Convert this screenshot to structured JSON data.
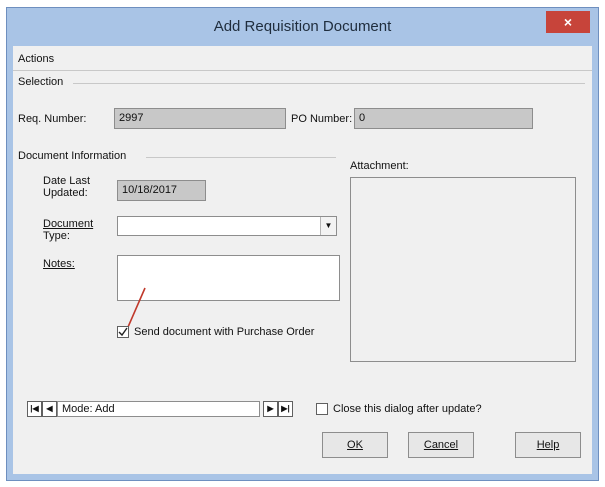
{
  "window": {
    "title": "Add Requisition Document",
    "close": "×"
  },
  "menu": {
    "actions": "Actions"
  },
  "selection": {
    "label": "Selection",
    "req_label": "Req. Number:",
    "req_value": "2997",
    "po_label": "PO Number:",
    "po_value": "0"
  },
  "doc_info": {
    "label": "Document Information",
    "date_label_1": "Date Last",
    "date_label_2": "Updated:",
    "date_value": "10/18/2017",
    "type_label_1": "Document",
    "type_label_2": "Type:",
    "type_value": "",
    "notes_label": "Notes:",
    "notes_value": "",
    "send_label": "Send document with Purchase Order",
    "send_checked": true
  },
  "attachment": {
    "label": "Attachment:"
  },
  "nav": {
    "first": "|◀",
    "prev": "◀",
    "next": "▶",
    "last": "▶|",
    "mode": "Mode: Add"
  },
  "close_dialog": {
    "label": "Close this dialog after update?",
    "checked": false
  },
  "buttons": {
    "ok": "OK",
    "cancel": "Cancel",
    "help": "Help"
  }
}
